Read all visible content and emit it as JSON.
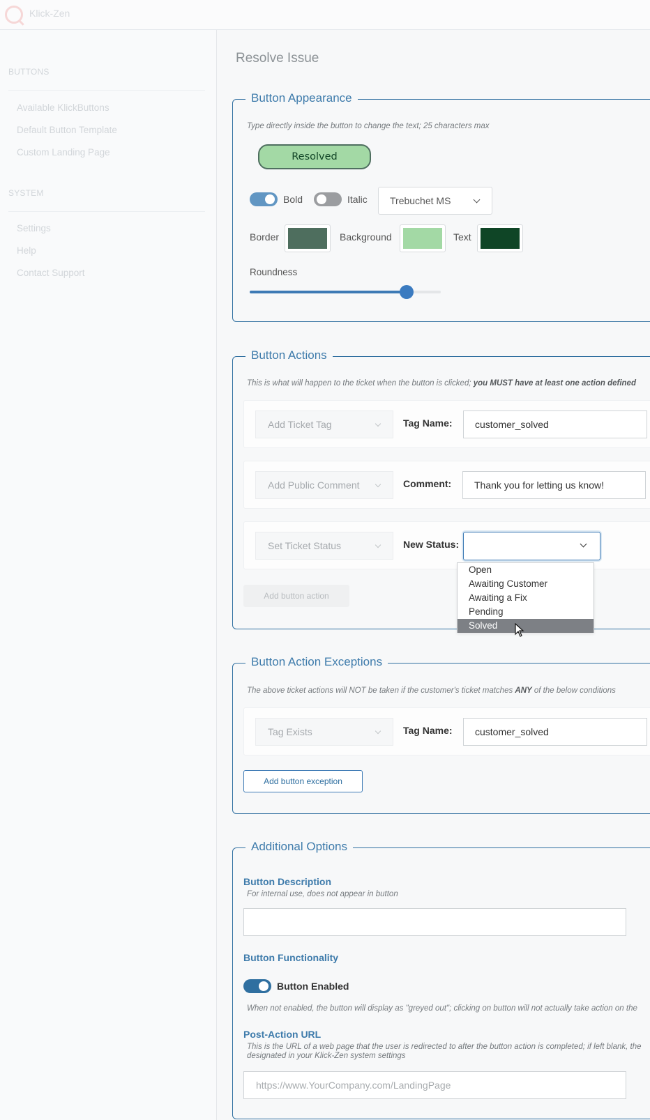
{
  "app": {
    "name": "Klick-Zen"
  },
  "sidebar": {
    "sections": [
      {
        "label": "BUTTONS",
        "items": [
          "Available KlickButtons",
          "Default Button Template",
          "Custom Landing Page"
        ]
      },
      {
        "label": "SYSTEM",
        "items": [
          "Settings",
          "Help",
          "Contact Support"
        ]
      }
    ]
  },
  "page": {
    "title": "Resolve Issue"
  },
  "appearance": {
    "legend": "Button Appearance",
    "hint": "Type directly inside the button to change the text; 25 characters max",
    "preview_label": "Resolved",
    "bold_label": "Bold",
    "bold_on": true,
    "italic_label": "Italic",
    "italic_on": false,
    "font": "Trebuchet MS",
    "border_label": "Border",
    "border_color": "#4e6e5e",
    "background_label": "Background",
    "background_color": "#a3d9a5",
    "text_label": "Text",
    "text_color": "#0f4526",
    "roundness_label": "Roundness",
    "roundness_value": 0.82
  },
  "actions": {
    "legend": "Button Actions",
    "hint": "This is what will happen to the ticket when the button is clicked; ",
    "hint_bold": "you MUST have at least one action defined",
    "rows": [
      {
        "type": "Add Ticket Tag",
        "label": "Tag Name:",
        "value": "customer_solved"
      },
      {
        "type": "Add Public Comment",
        "label": "Comment:",
        "value": "Thank you for letting us know!"
      },
      {
        "type": "Set Ticket Status",
        "label": "New Status:",
        "value": ""
      }
    ],
    "status_options": [
      "Open",
      "Awaiting Customer",
      "Awaiting a Fix",
      "Pending",
      "Solved"
    ],
    "status_highlighted": "Solved",
    "add_button": "Add button action"
  },
  "exceptions": {
    "legend": "Button Action Exceptions",
    "hint_a": "The above ticket actions will NOT be taken if the customer's ticket matches ",
    "hint_bold": "ANY",
    "hint_b": " of the below conditions",
    "row": {
      "type": "Tag Exists",
      "label": "Tag Name:",
      "value": "customer_solved"
    },
    "add_button": "Add button exception"
  },
  "options": {
    "legend": "Additional Options",
    "description_title": "Button Description",
    "description_hint": "For internal use, does not appear in button",
    "description_value": "",
    "functionality_title": "Button Functionality",
    "enabled_label": "Button Enabled",
    "enabled_on": true,
    "enabled_hint": "When not enabled, the button will display as \"greyed out\"; clicking on button will not actually take action on the",
    "url_title": "Post-Action URL",
    "url_hint_1": "This is the URL of a web page that the user is redirected to after the button action is completed; if left blank, the",
    "url_hint_2": "designated in your Klick-Zen system settings",
    "url_placeholder": "https://www.YourCompany.com/LandingPage"
  }
}
